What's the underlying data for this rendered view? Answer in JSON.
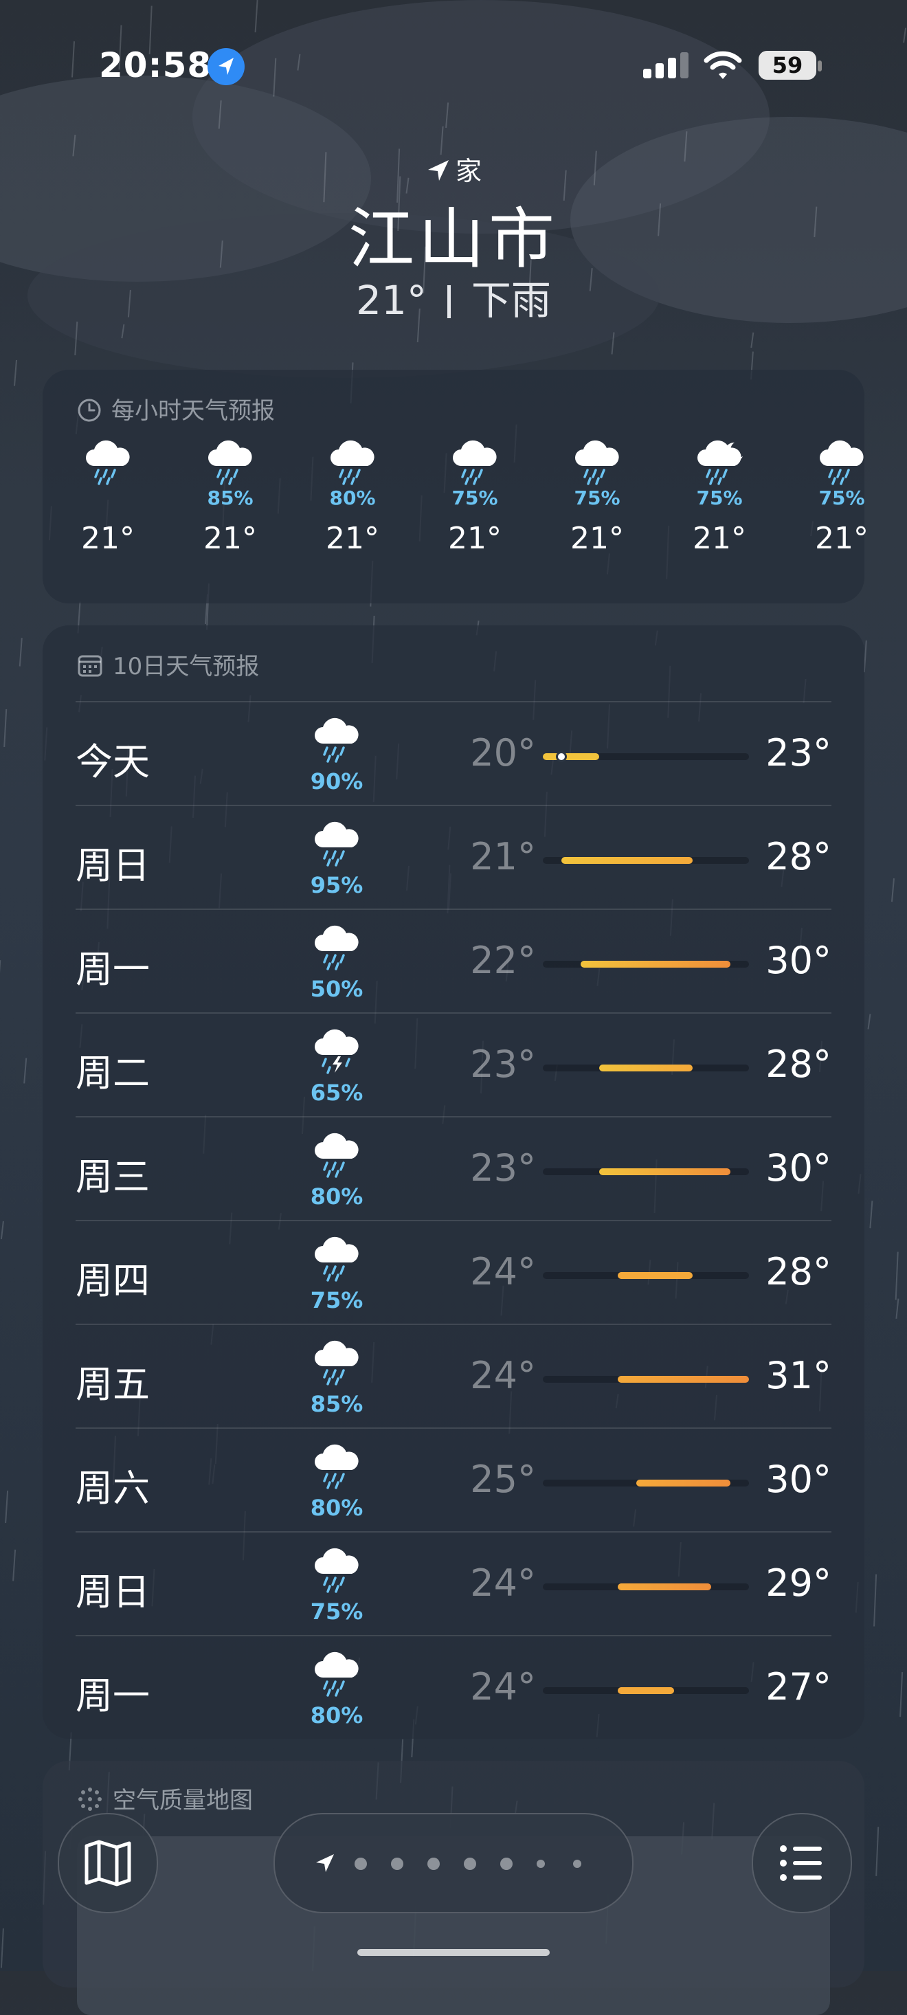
{
  "status_bar": {
    "time": "20:58",
    "battery": "59"
  },
  "header": {
    "home_label": "家",
    "city": "江山市",
    "temperature": "21°",
    "condition": "下雨"
  },
  "hourly": {
    "title": "每小时天气预报",
    "items": [
      {
        "icon": "cloud-rain-icon",
        "precip": "",
        "temp": "21°"
      },
      {
        "icon": "cloud-rain-icon",
        "precip": "85%",
        "temp": "21°"
      },
      {
        "icon": "cloud-rain-icon",
        "precip": "80%",
        "temp": "21°"
      },
      {
        "icon": "cloud-rain-icon",
        "precip": "75%",
        "temp": "21°"
      },
      {
        "icon": "cloud-rain-icon",
        "precip": "75%",
        "temp": "21°"
      },
      {
        "icon": "cloud-moon-rain-icon",
        "precip": "75%",
        "temp": "21°"
      },
      {
        "icon": "cloud-rain-icon",
        "precip": "75%",
        "temp": "21°"
      }
    ]
  },
  "daily": {
    "title": "10日天气预报",
    "range_min": 20,
    "range_max": 31,
    "current_temp": 21,
    "days": [
      {
        "day": "今天",
        "icon": "cloud-rain-icon",
        "precip": "90%",
        "low": "20°",
        "high": "23°",
        "low_v": 20,
        "high_v": 23
      },
      {
        "day": "周日",
        "icon": "cloud-rain-icon",
        "precip": "95%",
        "low": "21°",
        "high": "28°",
        "low_v": 21,
        "high_v": 28
      },
      {
        "day": "周一",
        "icon": "cloud-rain-icon",
        "precip": "50%",
        "low": "22°",
        "high": "30°",
        "low_v": 22,
        "high_v": 30
      },
      {
        "day": "周二",
        "icon": "cloud-bolt-rain-icon",
        "precip": "65%",
        "low": "23°",
        "high": "28°",
        "low_v": 23,
        "high_v": 28
      },
      {
        "day": "周三",
        "icon": "cloud-rain-icon",
        "precip": "80%",
        "low": "23°",
        "high": "30°",
        "low_v": 23,
        "high_v": 30
      },
      {
        "day": "周四",
        "icon": "cloud-rain-icon",
        "precip": "75%",
        "low": "24°",
        "high": "28°",
        "low_v": 24,
        "high_v": 28
      },
      {
        "day": "周五",
        "icon": "cloud-rain-icon",
        "precip": "85%",
        "low": "24°",
        "high": "31°",
        "low_v": 24,
        "high_v": 31
      },
      {
        "day": "周六",
        "icon": "cloud-rain-icon",
        "precip": "80%",
        "low": "25°",
        "high": "30°",
        "low_v": 25,
        "high_v": 30
      },
      {
        "day": "周日",
        "icon": "cloud-rain-icon",
        "precip": "75%",
        "low": "24°",
        "high": "29°",
        "low_v": 24,
        "high_v": 29
      },
      {
        "day": "周一",
        "icon": "cloud-rain-icon",
        "precip": "80%",
        "low": "24°",
        "high": "27°",
        "low_v": 24,
        "high_v": 27
      }
    ]
  },
  "air_quality": {
    "title": "空气质量地图"
  },
  "bottom_bar": {
    "page_count": 8
  }
}
